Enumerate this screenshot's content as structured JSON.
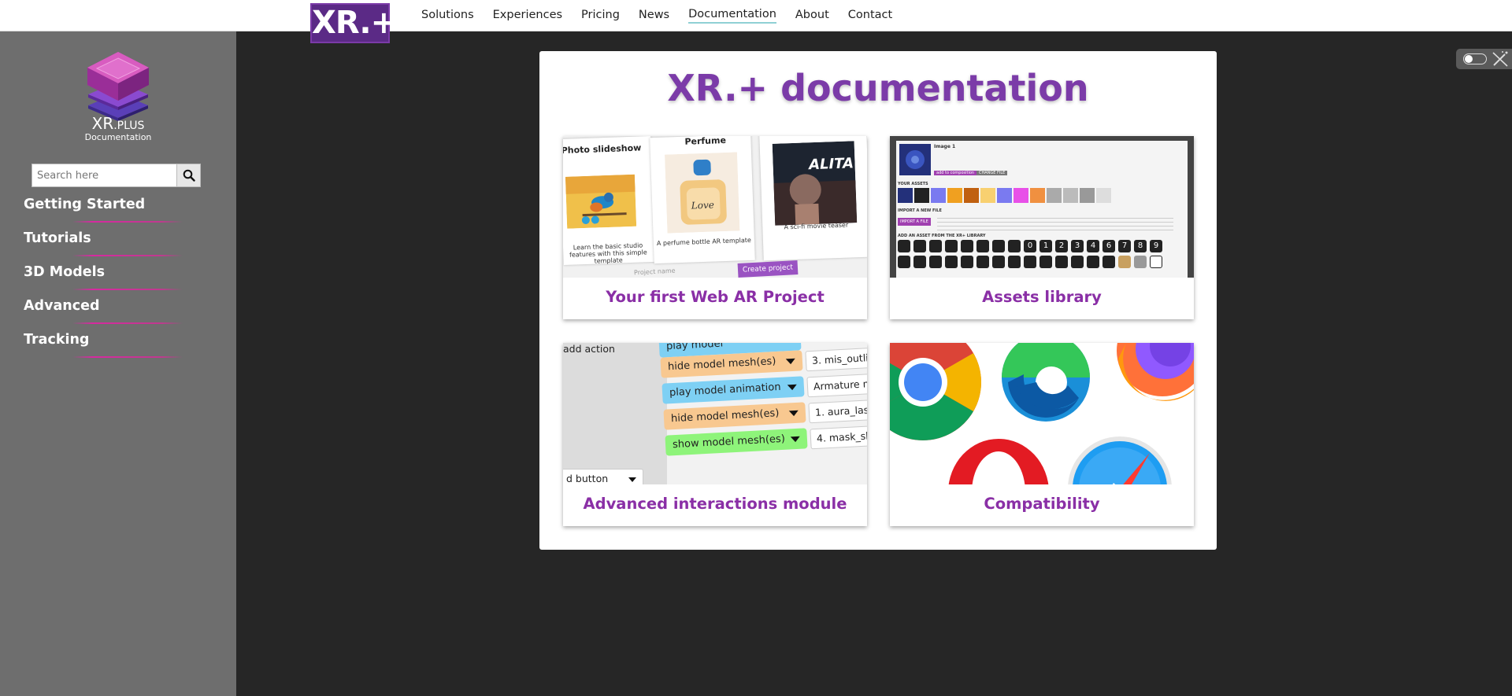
{
  "nav": {
    "logo": "XR.+",
    "items": [
      "Solutions",
      "Experiences",
      "Pricing",
      "News",
      "Documentation",
      "About",
      "Contact"
    ],
    "active": "Documentation"
  },
  "sidebar": {
    "brand_main": "XR",
    "brand_small": ".PLUS",
    "brand_sub": "Documentation",
    "search_placeholder": "Search here",
    "items": [
      "Getting Started",
      "Tutorials",
      "3D Models",
      "Advanced",
      "Tracking"
    ],
    "accent_color": "#d62aa0"
  },
  "main": {
    "title": "XR.+ documentation",
    "title_color": "#7b3ba8",
    "tiles": [
      {
        "title": "Your first Web AR Project",
        "thumb": {
          "headings": [
            "Photo slideshow",
            "Perfume"
          ],
          "captions": [
            "Learn the basic studio features with this simple template",
            "A perfume bottle AR template",
            "A sci-fi movie teaser"
          ],
          "button": "Create project",
          "name_placeholder": "Project name",
          "poster_text": "ALITA"
        }
      },
      {
        "title": "Assets library",
        "thumb": {
          "image_name": "Image 1",
          "sections": [
            "YOUR ASSETS",
            "IMPORT A NEW FILE",
            "ADD AN ASSET FROM THE XR+ LIBRARY"
          ],
          "buttons": [
            "add to composition",
            "CHANGE FILE",
            "IMPORT A FILE"
          ],
          "digits": [
            "0",
            "1",
            "2",
            "3",
            "4",
            "6",
            "7",
            "8",
            "9"
          ]
        }
      },
      {
        "title": "Advanced interactions module",
        "thumb": {
          "left_labels": [
            "add action",
            "d button"
          ],
          "actions": [
            "play model",
            "hide model mesh(es)",
            "play model animation",
            "hide model mesh(es)",
            "show model mesh(es)"
          ],
          "values": [
            "3. mis_outlin",
            "Armature m",
            "1. aura_lase",
            "4. mask_sl"
          ]
        }
      },
      {
        "title": "Compatibility",
        "thumb": {
          "browsers": [
            "chrome-icon",
            "edge-icon",
            "firefox-icon",
            "opera-icon",
            "safari-icon"
          ]
        }
      }
    ]
  }
}
